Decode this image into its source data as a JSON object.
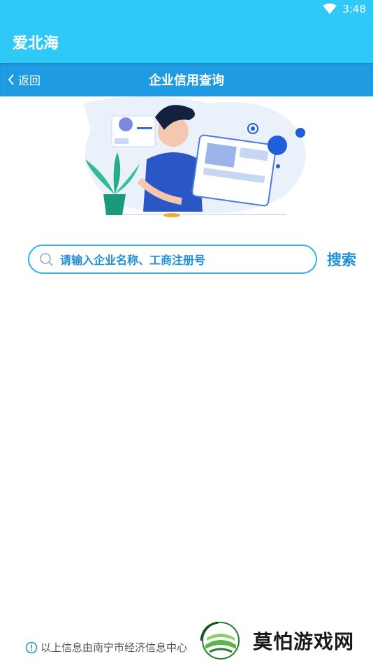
{
  "status_bar": {
    "time": "3:48",
    "wifi_icon": "wifi-icon"
  },
  "app": {
    "title": "爱北海"
  },
  "nav": {
    "back_label": "返回",
    "title": "企业信用查询"
  },
  "search": {
    "placeholder": "请输入企业名称、工商注册号",
    "button_label": "搜索"
  },
  "footer": {
    "notice": "以上信息由南宁市经济信息中心"
  },
  "watermark": {
    "text": "莫怕游戏网"
  },
  "colors": {
    "appbar": "#2ec9f7",
    "navbar": "#1f9be4",
    "accent": "#1f8fd8"
  }
}
